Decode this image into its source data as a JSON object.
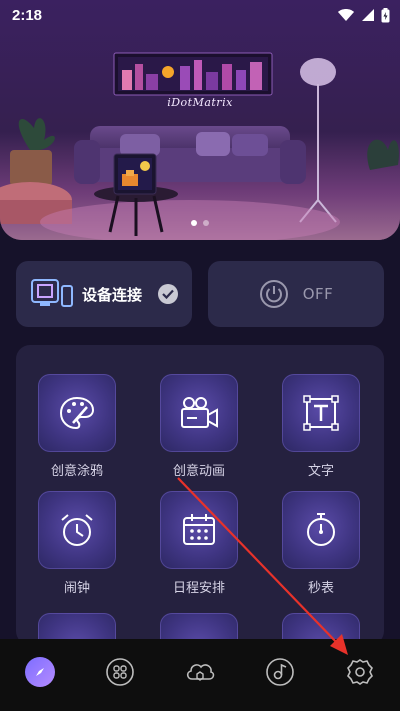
{
  "status_bar": {
    "time": "2:18"
  },
  "hero": {
    "brand": "iDotMatrix",
    "page_count": 2,
    "active_page": 1
  },
  "device_card": {
    "label": "设备连接",
    "connected": true
  },
  "power_card": {
    "label": "OFF"
  },
  "features": [
    {
      "label": "创意涂鸦",
      "icon": "palette-icon"
    },
    {
      "label": "创意动画",
      "icon": "video-camera-icon"
    },
    {
      "label": "文字",
      "icon": "text-icon"
    },
    {
      "label": "闹钟",
      "icon": "alarm-clock-icon"
    },
    {
      "label": "日程安排",
      "icon": "calendar-icon"
    },
    {
      "label": "秒表",
      "icon": "stopwatch-icon"
    }
  ],
  "bottom_nav": [
    {
      "icon": "compass-icon",
      "active": true
    },
    {
      "icon": "grid-icon",
      "active": false
    },
    {
      "icon": "cloud-icon",
      "active": false
    },
    {
      "icon": "music-icon",
      "active": false
    },
    {
      "icon": "settings-icon",
      "active": false
    }
  ],
  "colors": {
    "accent": "#7d6dff",
    "panel": "#25213f",
    "card": "#2c2a4a",
    "annotation": "#e8322a"
  }
}
